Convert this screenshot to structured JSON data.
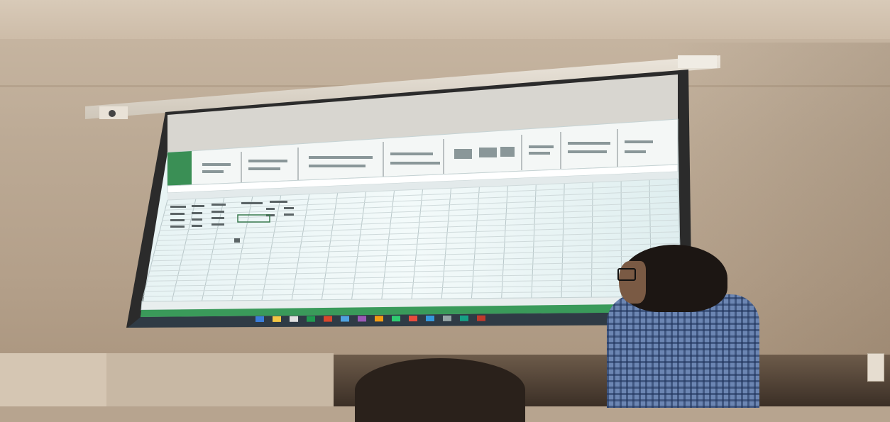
{
  "scene": {
    "description_labels": {
      "room": "classroom",
      "projection": "spreadsheet"
    }
  },
  "colors": {
    "wall": "#bcaa95",
    "screen_bezel": "#2a2a2a",
    "screen_background": "#eef6f7",
    "grid_line": "#b8c7c9",
    "ribbon": "#f4f7f6",
    "status_bar": "#3a9a5a",
    "taskbar": "#2f3b45",
    "shirt": "#6c86b3"
  },
  "spreadsheet": {
    "columns": 18,
    "rows": 20,
    "taskbar_icons": 14
  }
}
